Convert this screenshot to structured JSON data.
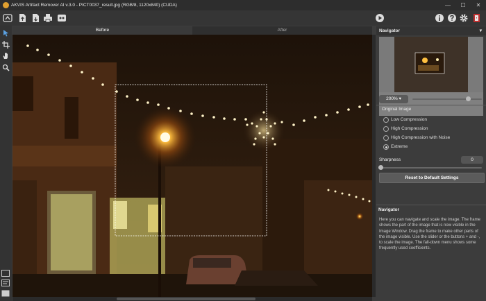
{
  "window": {
    "title": "AKVIS Artifact Remover AI v.3.0 - PICT0037_result.jpg (RGB/8, 1120x840) (CUDA)",
    "minimize": "—",
    "maximize": "☐",
    "close": "✕"
  },
  "toolbar": {
    "buttons": [
      "home-icon",
      "open-icon",
      "save-icon",
      "print-icon",
      "share-icon"
    ],
    "run": "play-icon",
    "right": [
      "info-icon",
      "help-icon",
      "settings-icon",
      "exit-icon"
    ]
  },
  "tools": [
    "hand-pointer-icon",
    "crop-icon",
    "hand-icon",
    "zoom-icon"
  ],
  "tabs": {
    "before": "Before",
    "after": "After"
  },
  "navigator": {
    "title": "Navigator",
    "zoom": "200%",
    "zoom_slider": 0.8
  },
  "settings": {
    "section": "Original Image",
    "options": [
      "Low Compression",
      "High Compression",
      "High Compression with Noise",
      "Extreme"
    ],
    "selected": "Extreme",
    "sharpness_label": "Sharpness",
    "sharpness_value": "0",
    "reset_label": "Reset to Default Settings"
  },
  "help": {
    "title": "Navigator",
    "text": "Here you can navigate and scale the image. The frame shows the part of the image that is now visible in the Image Window. Drag the frame to make other parts of the image visible. Use the slider or the buttons + and -, to scale the image. The fall-down menu shows some frequently used coefficients."
  },
  "colors": {
    "accent": "#e0a030",
    "panel": "#3c3c3c",
    "titlebar": "#2d2d2d"
  }
}
